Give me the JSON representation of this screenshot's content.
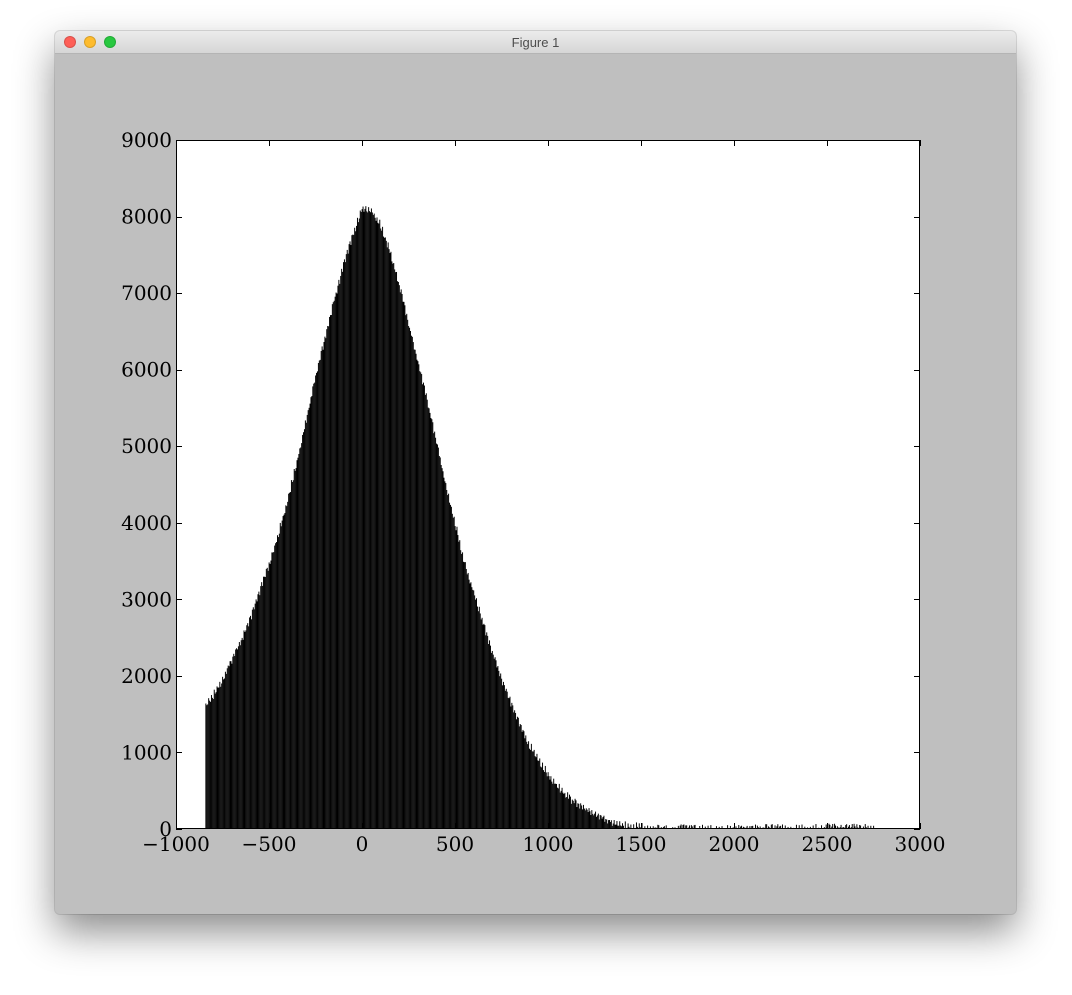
{
  "window": {
    "title": "Figure 1",
    "buttons": {
      "close_color": "#fe5f57",
      "minimize_color": "#febc2e",
      "maximize_color": "#28c840"
    }
  },
  "figure": {
    "background": "#bfbfbf",
    "axes_background": "#ffffff",
    "bar_color": "#000000"
  },
  "chart_data": {
    "type": "bar",
    "title": "",
    "xlabel": "",
    "ylabel": "",
    "xlim": [
      -1000,
      3000
    ],
    "ylim": [
      0,
      9000
    ],
    "grid": false,
    "legend": "none",
    "x_ticks": [
      -1000,
      -500,
      0,
      500,
      1000,
      1500,
      2000,
      2500,
      3000
    ],
    "x_tick_labels": [
      "−1000",
      "−500",
      "0",
      "500",
      "1000",
      "1500",
      "2000",
      "2500",
      "3000"
    ],
    "y_ticks": [
      0,
      1000,
      2000,
      3000,
      4000,
      5000,
      6000,
      7000,
      8000,
      9000
    ],
    "y_tick_labels": [
      "0",
      "1000",
      "2000",
      "3000",
      "4000",
      "5000",
      "6000",
      "7000",
      "8000",
      "9000"
    ],
    "x_range": [
      -842,
      2758
    ],
    "x": [
      -840,
      -800,
      -750,
      -700,
      -650,
      -600,
      -550,
      -500,
      -450,
      -400,
      -350,
      -300,
      -250,
      -200,
      -150,
      -100,
      -50,
      0,
      50,
      100,
      150,
      200,
      250,
      300,
      350,
      400,
      450,
      500,
      550,
      600,
      650,
      700,
      750,
      800,
      850,
      900,
      950,
      1000,
      1050,
      1100,
      1150,
      1200,
      1250,
      1300,
      1350,
      1400,
      1450,
      1500,
      1550,
      1600,
      1650,
      1700,
      1800,
      1900,
      2000,
      2100,
      2200,
      2300,
      2400,
      2500,
      2600,
      2700,
      2758
    ],
    "values": [
      1600,
      1750,
      1950,
      2200,
      2450,
      2750,
      3100,
      3450,
      3850,
      4300,
      4800,
      5350,
      5900,
      6400,
      6900,
      7350,
      7750,
      8100,
      8100,
      7900,
      7550,
      7100,
      6600,
      6100,
      5600,
      5050,
      4500,
      4000,
      3500,
      3100,
      2700,
      2300,
      1950,
      1650,
      1350,
      1100,
      900,
      720,
      570,
      440,
      330,
      250,
      180,
      130,
      90,
      60,
      40,
      25,
      15,
      10,
      8,
      6,
      5,
      5,
      6,
      8,
      10,
      12,
      14,
      15,
      15,
      12,
      10
    ]
  }
}
